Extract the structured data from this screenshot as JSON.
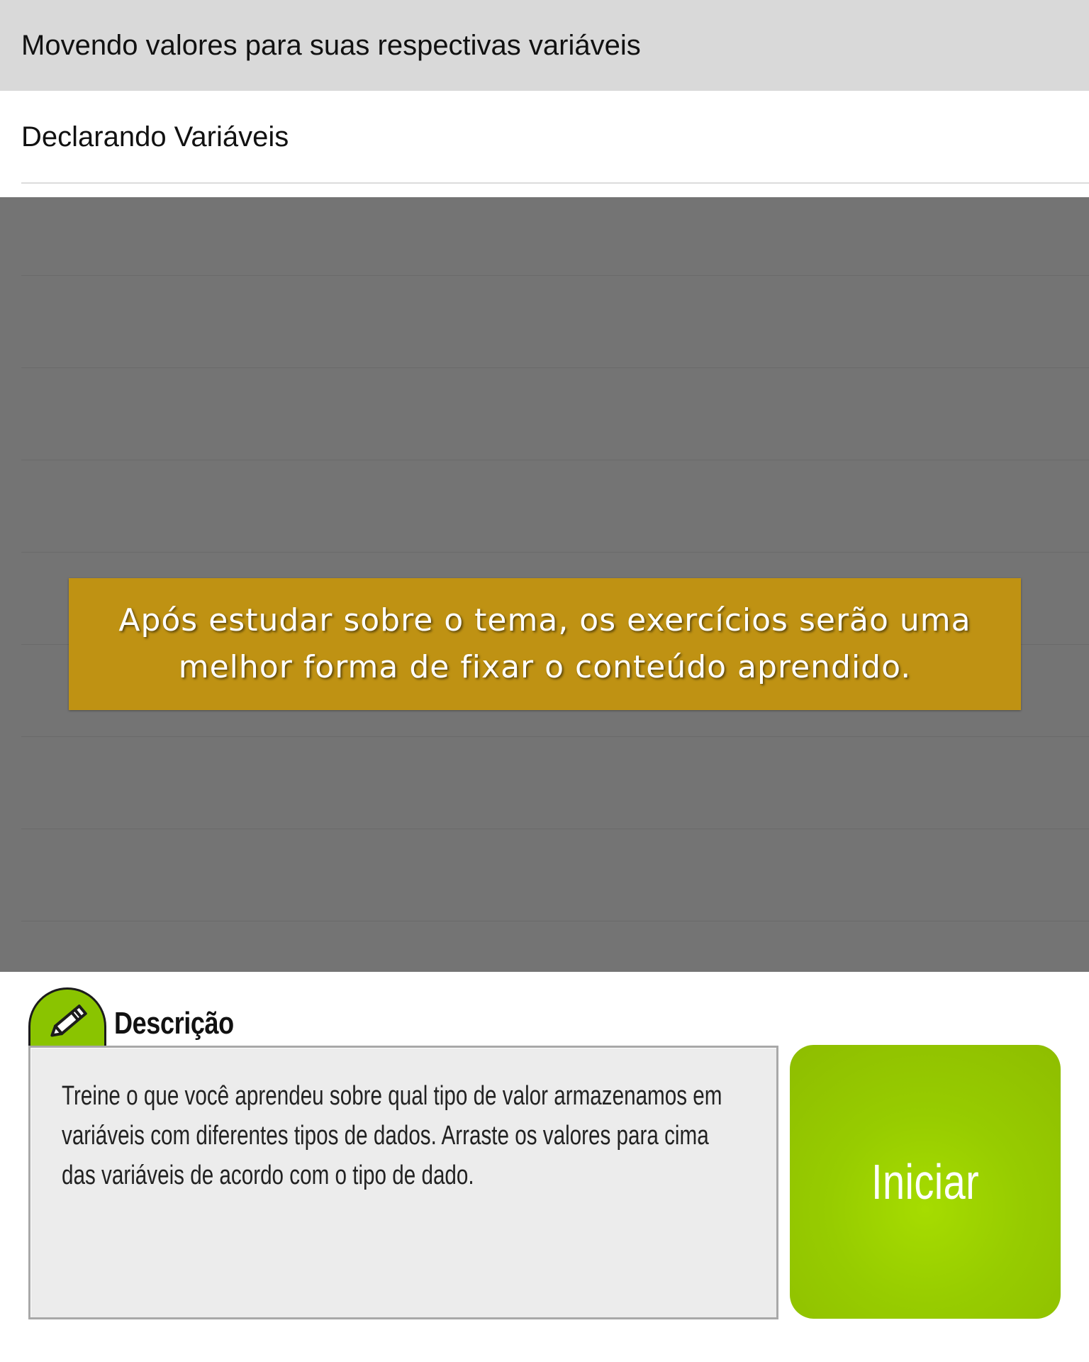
{
  "list": {
    "items": [
      {
        "label": "Movendo valores para suas respectivas variáveis"
      },
      {
        "label": "Declarando Variáveis"
      }
    ]
  },
  "tip": {
    "text": "Após estudar sobre o tema, os exercícios serão uma melhor forma de fixar o conteúdo aprendido.",
    "color": "#bf9213"
  },
  "description": {
    "icon": "pencil-icon",
    "title": "Descrição",
    "text": "Treine o que você aprendeu sobre qual tipo de valor armazenamos em variáveis com diferentes tipos de dados. Arraste os valores para cima das variáveis de acordo com o tipo de dado."
  },
  "start_button": {
    "label": "Iniciar",
    "color": "#97cc00"
  }
}
